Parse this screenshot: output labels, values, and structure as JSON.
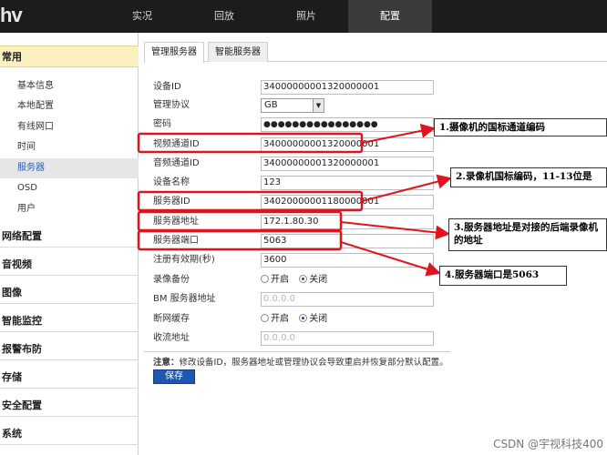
{
  "brand": {
    "logo_text": "hv"
  },
  "nav": {
    "items": [
      {
        "label": "实况"
      },
      {
        "label": "回放"
      },
      {
        "label": "照片"
      },
      {
        "label": "配置"
      }
    ],
    "active_index": 3
  },
  "sidebar": {
    "head": "常用",
    "items": [
      {
        "label": "基本信息"
      },
      {
        "label": "本地配置"
      },
      {
        "label": "有线网口"
      },
      {
        "label": "时间"
      },
      {
        "label": "服务器"
      },
      {
        "label": "OSD"
      },
      {
        "label": "用户"
      }
    ],
    "active_item": "服务器",
    "groups": [
      {
        "label": "网络配置"
      },
      {
        "label": "音视频"
      },
      {
        "label": "图像"
      },
      {
        "label": "智能监控"
      },
      {
        "label": "报警布防"
      },
      {
        "label": "存储"
      },
      {
        "label": "安全配置"
      },
      {
        "label": "系统"
      }
    ]
  },
  "tabs": [
    {
      "label": "管理服务器"
    },
    {
      "label": "智能服务器"
    }
  ],
  "active_tab": "管理服务器",
  "form": {
    "device_id": {
      "label": "设备ID",
      "value": "34000000001320000001"
    },
    "protocol": {
      "label": "管理协议",
      "value": "GB"
    },
    "password": {
      "label": "密码",
      "value": "●●●●●●●●●●●●●●●●"
    },
    "video_channel_id": {
      "label": "视频通道ID",
      "value": "34000000001320000001"
    },
    "audio_channel_id": {
      "label": "音频通道ID",
      "value": "34000000001320000001"
    },
    "device_name": {
      "label": "设备名称",
      "value": "123"
    },
    "server_id": {
      "label": "服务器ID",
      "value": "34020000001180000001"
    },
    "server_address": {
      "label": "服务器地址",
      "value": "172.1.80.30"
    },
    "server_port": {
      "label": "服务器端口",
      "value": "5063"
    },
    "registration_validity": {
      "label": "注册有效期(秒)",
      "value": "3600"
    },
    "recording_backup": {
      "label": "录像备份",
      "options": [
        "开启",
        "关闭"
      ],
      "selected": "关闭"
    },
    "bm_server_address": {
      "label": "BM 服务器地址",
      "placeholder": "0.0.0.0"
    },
    "offline_cache": {
      "label": "断网缓存",
      "options": [
        "开启",
        "关闭"
      ],
      "selected": "关闭"
    },
    "collection_address": {
      "label": "收流地址",
      "placeholder": "0.0.0.0"
    }
  },
  "note": {
    "prefix": "注意：",
    "text": "修改设备ID，服务器地址或管理协议会导致重启并恢复部分默认配置。"
  },
  "save_label": "保存",
  "annotations": [
    {
      "text": "1.摄像机的国标通道编码"
    },
    {
      "text": "2.录像机国标编码，11-13位是"
    },
    {
      "text": "3.服务器地址是对接的后端录像机的地址"
    },
    {
      "text": "4.服务器端口是5063"
    }
  ],
  "colors": {
    "annotation": "#e0141e",
    "accent": "#1e56b0",
    "sidebar_head": "#fbf0c0"
  },
  "watermark": "CSDN @宇视科技400"
}
